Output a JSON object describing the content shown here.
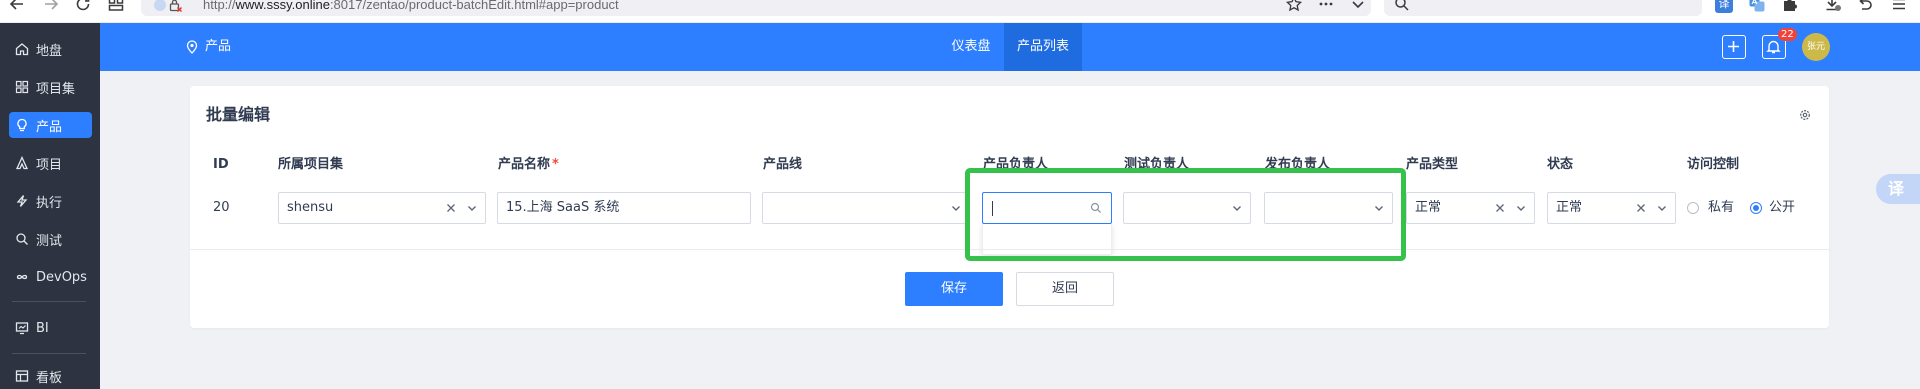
{
  "browser": {
    "url_prefix": "http://",
    "url_host": "www.sssy.online",
    "url_suffix": ":8017/zentao/product-batchEdit.html#app=product",
    "ext_translate_glyph": "译"
  },
  "sidebar": {
    "items": [
      {
        "label": "地盘",
        "icon": "home-icon"
      },
      {
        "label": "项目集",
        "icon": "grid-icon"
      },
      {
        "label": "产品",
        "icon": "lightbulb-icon",
        "active": true
      },
      {
        "label": "项目",
        "icon": "project-icon"
      },
      {
        "label": "执行",
        "icon": "execution-icon"
      },
      {
        "label": "测试",
        "icon": "test-icon"
      },
      {
        "label": "DevOps",
        "icon": "infinity-icon"
      },
      {
        "label": "BI",
        "icon": "bi-icon"
      },
      {
        "label": "看板",
        "icon": "kanban-icon"
      }
    ]
  },
  "header": {
    "location": "产品",
    "nav": [
      {
        "label": "仪表盘"
      },
      {
        "label": "产品列表",
        "active": true
      }
    ],
    "notification_count": "22",
    "avatar_text": "张元"
  },
  "form": {
    "title": "批量编辑",
    "columns": [
      "ID",
      "所属项目集",
      "产品名称",
      "产品线",
      "产品负责人",
      "测试负责人",
      "发布负责人",
      "产品类型",
      "状态",
      "访问控制"
    ],
    "required_mark": "*",
    "row": {
      "id": "20",
      "program": "shensu",
      "name": "15.上海 SaaS 系统",
      "type": "正常",
      "status": "正常",
      "acl_options": [
        "私有",
        "公开"
      ],
      "acl_selected": "公开"
    },
    "buttons": {
      "save": "保存",
      "back": "返回"
    }
  },
  "float_translate": "译",
  "colors": {
    "brand_blue": "#2e7fff",
    "sidebar_bg": "#2d3340",
    "highlight_green": "#36c04c",
    "badge_red": "#f0443a",
    "avatar_bg": "#cdb94a"
  }
}
